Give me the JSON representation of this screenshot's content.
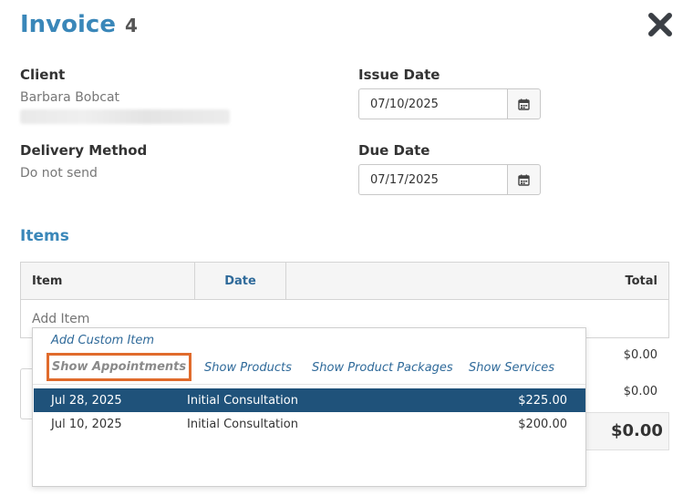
{
  "header": {
    "title": "Invoice",
    "number": "4"
  },
  "client": {
    "label": "Client",
    "name": "Barbara Bobcat"
  },
  "delivery": {
    "label": "Delivery Method",
    "value": "Do not send"
  },
  "issue_date": {
    "label": "Issue Date",
    "value": "07/10/2025"
  },
  "due_date": {
    "label": "Due Date",
    "value": "07/17/2025"
  },
  "items": {
    "title": "Items",
    "columns": {
      "item": "Item",
      "date": "Date",
      "total": "Total"
    },
    "add_placeholder": "Add Item",
    "subtotal": "$0.00",
    "tax": "$0.00",
    "grand_total": "$0.00"
  },
  "dropdown": {
    "add_custom": "Add Custom Item",
    "tabs": {
      "appointments": "Show Appointments",
      "products": "Show Products",
      "packages": "Show Product Packages",
      "services": "Show Services"
    },
    "appointments": [
      {
        "date": "Jul 28, 2025",
        "name": "Initial Consultation",
        "price": "$225.00"
      },
      {
        "date": "Jul 10, 2025",
        "name": "Initial Consultation",
        "price": "$200.00"
      }
    ]
  },
  "colors": {
    "accent": "#3a87b9",
    "selected_row": "#1f527a",
    "highlight_border": "#e06b2c"
  }
}
